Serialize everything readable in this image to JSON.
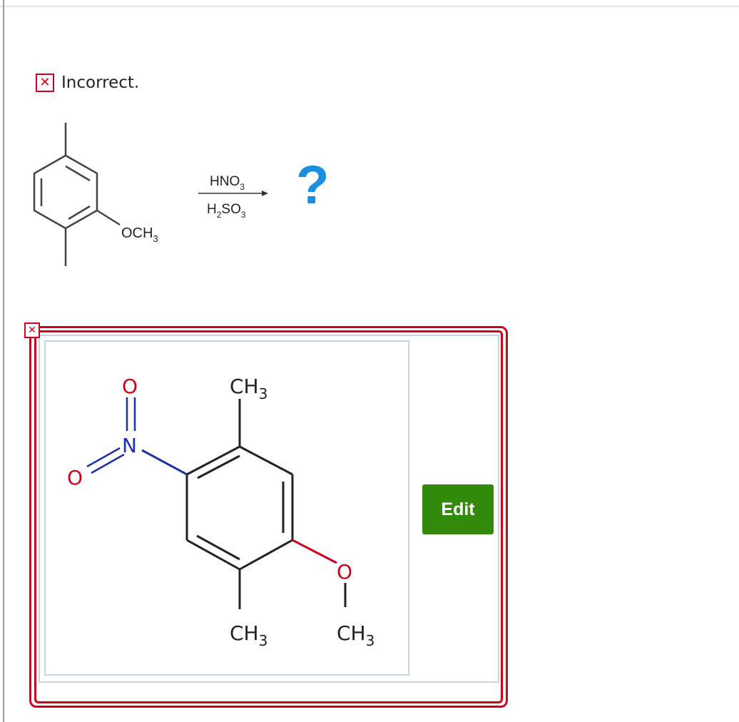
{
  "feedback": {
    "status_text": "Incorrect."
  },
  "reaction": {
    "reagent_top": "HNO3",
    "reagent_bottom": "H2SO3",
    "substituent": "OCH3",
    "unknown_product": "?"
  },
  "answer": {
    "edit_label": "Edit",
    "labels": {
      "top_methyl": "CH3",
      "bottom_methyl": "CH3",
      "methoxy_methyl": "CH3",
      "nitro_atom": "N",
      "oxygen_top": "O",
      "oxygen_left": "O",
      "methoxy_oxygen": "O"
    }
  },
  "colors": {
    "error_red": "#d0021b",
    "accent_blue": "#1a8fe0",
    "edit_green": "#338a0a"
  }
}
